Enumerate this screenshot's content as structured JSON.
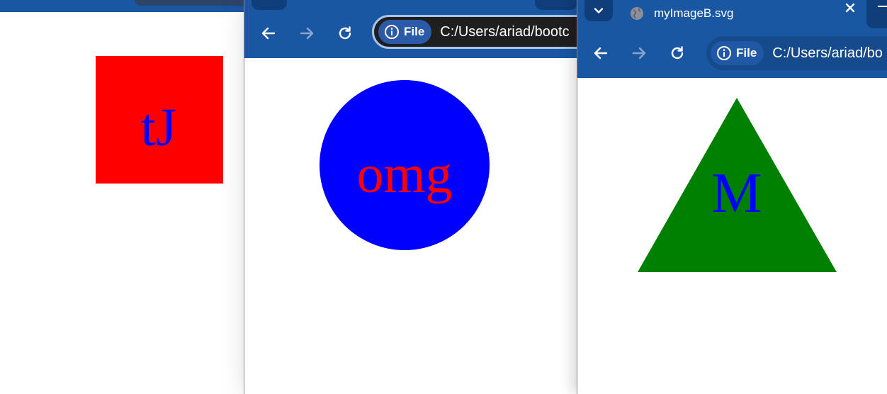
{
  "colors": {
    "chrome_blue": "#1a57a3",
    "omnibox_dark": "#1f1f1f",
    "red": "#ff0000",
    "blue": "#0000ff",
    "green": "#008000",
    "white": "#ffffff"
  },
  "window_left": {
    "image": {
      "shape": "square",
      "fill": "#ff0000",
      "text": "tJ",
      "text_color": "#0000ff"
    }
  },
  "window_middle": {
    "toolbar": {
      "back_icon": "arrow-left-icon",
      "forward_icon": "arrow-right-icon",
      "reload_icon": "reload-icon"
    },
    "omnibox": {
      "chip_icon": "info-icon",
      "chip_label": "File",
      "url": "C:/Users/ariad/bootc"
    },
    "image": {
      "shape": "circle",
      "fill": "#0000ff",
      "text": "omg",
      "text_color": "#ff0000"
    }
  },
  "window_right": {
    "tab": {
      "search_icon": "chevron-down-icon",
      "favicon": "globe-icon",
      "title": "myImageB.svg",
      "close_icon": "close-icon"
    },
    "toolbar": {
      "back_icon": "arrow-left-icon",
      "forward_icon": "arrow-right-icon",
      "reload_icon": "reload-icon"
    },
    "omnibox": {
      "chip_icon": "info-icon",
      "chip_label": "File",
      "url": "C:/Users/ariad/bo"
    },
    "image": {
      "shape": "triangle",
      "fill": "#008000",
      "text": "M",
      "text_color": "#0000ff"
    }
  }
}
